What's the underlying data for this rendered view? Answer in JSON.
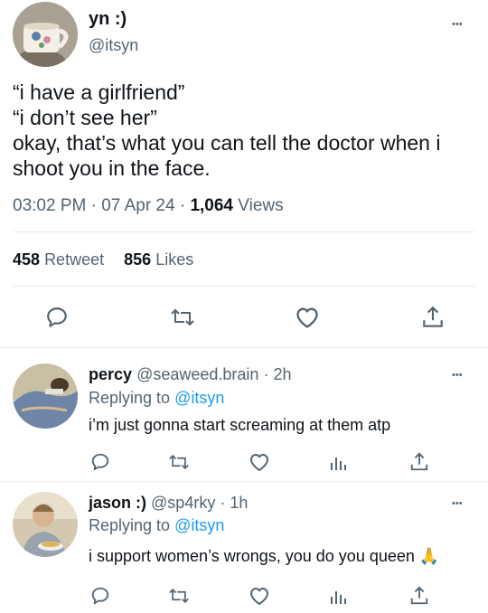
{
  "main_tweet": {
    "display_name": "yn :)",
    "handle": "@itsyn",
    "text_lines": [
      "“i have a girlfriend”",
      "“i don’t see her”",
      "okay, that’s what you can tell the doctor when i",
      "shoot you in the face."
    ],
    "time": "03:02 PM",
    "date": "07 Apr 24",
    "views_count": "1,064",
    "views_label": "Views",
    "retweets_count": "458",
    "retweets_label": "Retweet",
    "likes_count": "856",
    "likes_label": "Likes"
  },
  "replies": [
    {
      "display_name": "percy",
      "handle": "@seaweed.brain",
      "time": "2h",
      "replying_label": "Replying to",
      "replying_to": "@itsyn",
      "text": "i’m just gonna start screaming at them atp"
    },
    {
      "display_name": "jason :)",
      "handle": "@sp4rky",
      "time": "1h",
      "replying_label": "Replying to",
      "replying_to": "@itsyn",
      "text": "i support women’s wrongs, you do you queen 🙏"
    }
  ],
  "separator": "·",
  "more_glyph": "•••",
  "colors": {
    "accent": "#1d9bf0",
    "secondary_text": "#536471",
    "divider": "#e6ecf0"
  },
  "icons": [
    "reply-icon",
    "retweet-icon",
    "like-icon",
    "share-icon",
    "analytics-icon",
    "more-icon"
  ]
}
